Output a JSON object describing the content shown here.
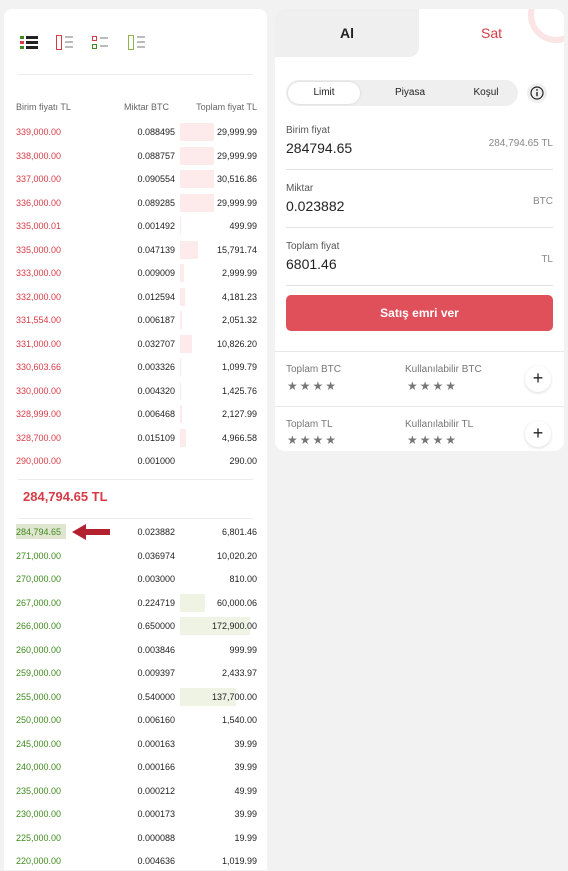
{
  "colors": {
    "ask": "#d63b46",
    "bid": "#3f8a1f",
    "accent": "#e0505a"
  },
  "view_icons": [
    "all-orders-view-icon",
    "sell-orders-view-icon",
    "split-view-icon",
    "buy-orders-view-icon"
  ],
  "orderbook": {
    "headers": {
      "price": "Birim fiyatı TL",
      "qty": "Miktar BTC",
      "total": "Toplam fiyat TL"
    },
    "asks": [
      {
        "price": "339,000.00",
        "qty": "0.088495",
        "total": "29,999.99",
        "depth": 0.48
      },
      {
        "price": "338,000.00",
        "qty": "0.088757",
        "total": "29,999.99",
        "depth": 0.48
      },
      {
        "price": "337,000.00",
        "qty": "0.090554",
        "total": "30,516.86",
        "depth": 0.49
      },
      {
        "price": "336,000.00",
        "qty": "0.089285",
        "total": "29,999.99",
        "depth": 0.48
      },
      {
        "price": "335,000.01",
        "qty": "0.001492",
        "total": "499.99",
        "depth": 0.01
      },
      {
        "price": "335,000.00",
        "qty": "0.047139",
        "total": "15,791.74",
        "depth": 0.25
      },
      {
        "price": "333,000.00",
        "qty": "0.009009",
        "total": "2,999.99",
        "depth": 0.05
      },
      {
        "price": "332,000.00",
        "qty": "0.012594",
        "total": "4,181.23",
        "depth": 0.07
      },
      {
        "price": "331,554.00",
        "qty": "0.006187",
        "total": "2,051.32",
        "depth": 0.03
      },
      {
        "price": "331,000.00",
        "qty": "0.032707",
        "total": "10,826.20",
        "depth": 0.17
      },
      {
        "price": "330,603.66",
        "qty": "0.003326",
        "total": "1,099.79",
        "depth": 0.02
      },
      {
        "price": "330,000.00",
        "qty": "0.004320",
        "total": "1,425.76",
        "depth": 0.02
      },
      {
        "price": "328,999.00",
        "qty": "0.006468",
        "total": "2,127.99",
        "depth": 0.03
      },
      {
        "price": "328,700.00",
        "qty": "0.015109",
        "total": "4,966.58",
        "depth": 0.08
      },
      {
        "price": "290,000.00",
        "qty": "0.001000",
        "total": "290.00",
        "depth": 0.005
      }
    ],
    "mid_price": "284,794.65 TL",
    "bids": [
      {
        "price": "284,794.65",
        "qty": "0.023882",
        "total": "6,801.46",
        "depth": 0.0
      },
      {
        "price": "271,000.00",
        "qty": "0.036974",
        "total": "10,020.20",
        "depth": 0.0
      },
      {
        "price": "270,000.00",
        "qty": "0.003000",
        "total": "810.00",
        "depth": 0.0
      },
      {
        "price": "267,000.00",
        "qty": "0.224719",
        "total": "60,000.06",
        "depth": 0.35
      },
      {
        "price": "266,000.00",
        "qty": "0.650000",
        "total": "172,900.00",
        "depth": 1.0
      },
      {
        "price": "260,000.00",
        "qty": "0.003846",
        "total": "999.99",
        "depth": 0.0
      },
      {
        "price": "259,000.00",
        "qty": "0.009397",
        "total": "2,433.97",
        "depth": 0.0
      },
      {
        "price": "255,000.00",
        "qty": "0.540000",
        "total": "137,700.00",
        "depth": 0.8
      },
      {
        "price": "250,000.00",
        "qty": "0.006160",
        "total": "1,540.00",
        "depth": 0.0
      },
      {
        "price": "245,000.00",
        "qty": "0.000163",
        "total": "39.99",
        "depth": 0.0
      },
      {
        "price": "240,000.00",
        "qty": "0.000166",
        "total": "39.99",
        "depth": 0.0
      },
      {
        "price": "235,000.00",
        "qty": "0.000212",
        "total": "49.99",
        "depth": 0.0
      },
      {
        "price": "230,000.00",
        "qty": "0.000173",
        "total": "39.99",
        "depth": 0.0
      },
      {
        "price": "225,000.00",
        "qty": "0.000088",
        "total": "19.99",
        "depth": 0.0
      },
      {
        "price": "220,000.00",
        "qty": "0.004636",
        "total": "1,019.99",
        "depth": 0.0
      }
    ]
  },
  "order_form": {
    "tab_buy": "Al",
    "tab_sell": "Sat",
    "types": [
      "Limit",
      "Piyasa",
      "Koşul"
    ],
    "selected_type": "Limit",
    "info_icon": "info-icon",
    "unit_price": {
      "label": "Birim fiyat",
      "value": "284794.65",
      "suffix": "284,794.65  TL"
    },
    "amount": {
      "label": "Miktar",
      "value": "0.023882",
      "suffix": "BTC"
    },
    "total": {
      "label": "Toplam fiyat",
      "value": "6801.46",
      "suffix": "TL"
    },
    "submit": "Satış emri ver"
  },
  "balances": {
    "btc_total_label": "Toplam BTC",
    "btc_available_label": "Kullanılabilir BTC",
    "tl_total_label": "Toplam TL",
    "tl_available_label": "Kullanılabilir TL",
    "masked": "★★★★",
    "add_icon": "plus-icon"
  }
}
